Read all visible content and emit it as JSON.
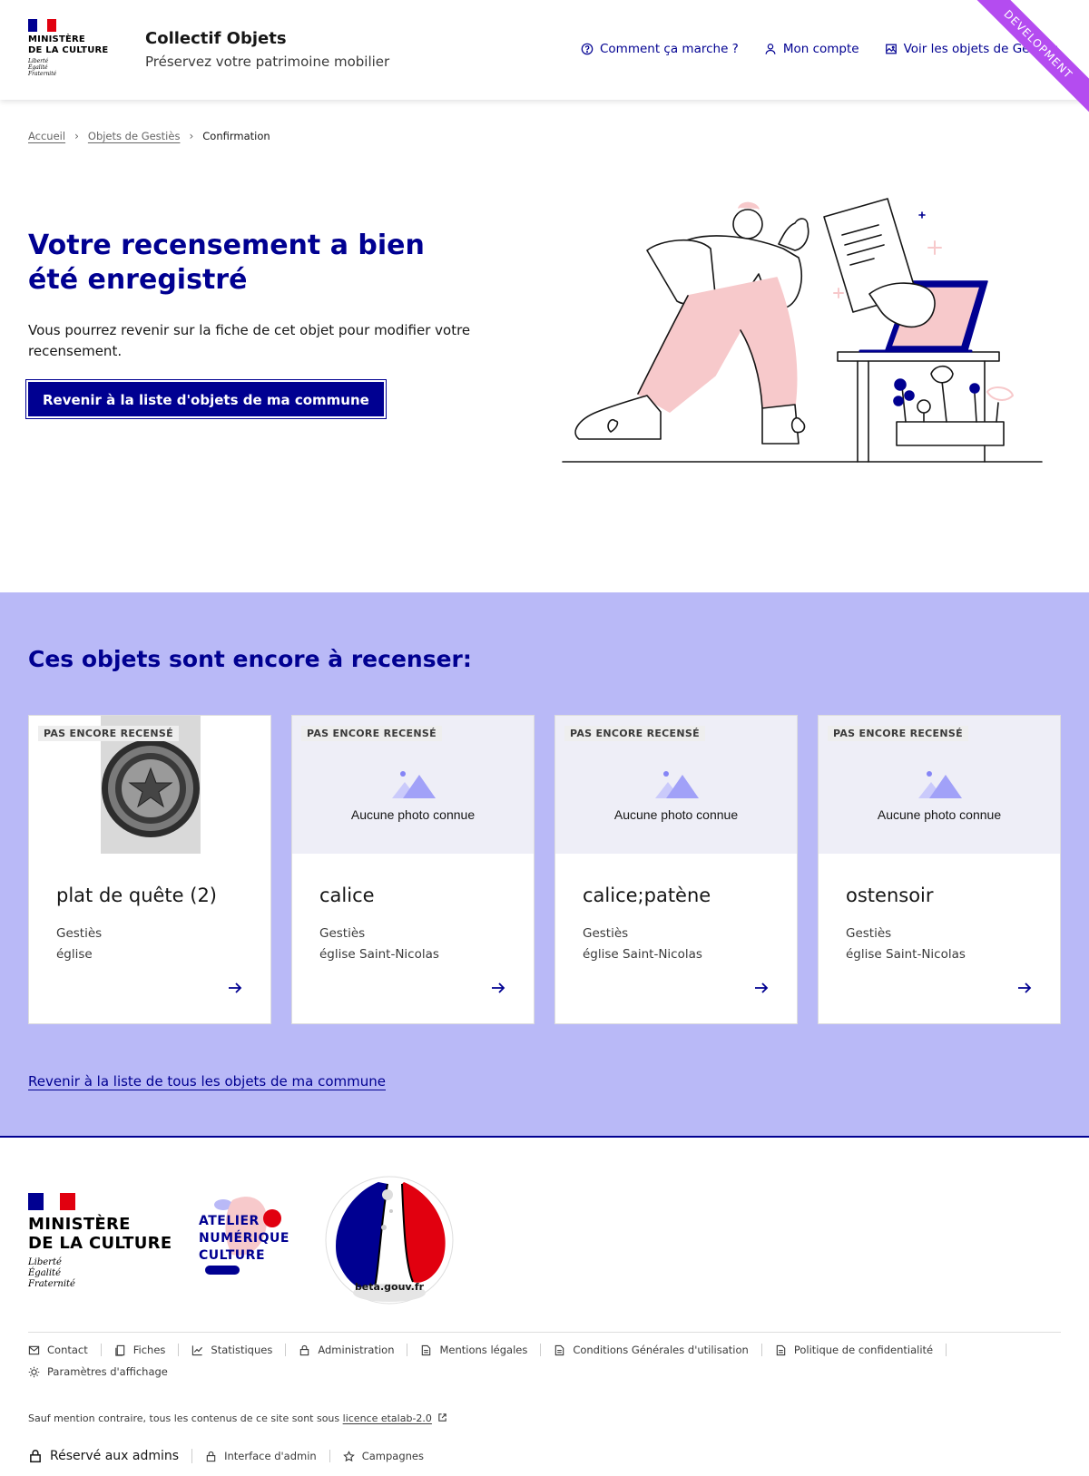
{
  "header": {
    "ministry_lines": [
      "MINISTÈRE",
      "DE LA CULTURE"
    ],
    "devise_lines": [
      "Liberté",
      "Égalité",
      "Fraternité"
    ],
    "site_title": "Collectif Objets",
    "tagline": "Préservez votre patrimoine mobilier",
    "nav": [
      {
        "label": "Comment ça marche ?",
        "icon": "question-circle-icon"
      },
      {
        "label": "Mon compte",
        "icon": "user-icon"
      },
      {
        "label": "Voir les objets de Gestiès",
        "icon": "image-icon"
      }
    ],
    "env_ribbon": "DEVELOPMENT"
  },
  "breadcrumb": {
    "items": [
      "Accueil",
      "Objets de Gestiès"
    ],
    "current": "Confirmation"
  },
  "hero": {
    "title": "Votre recensement a bien été enregistré",
    "text": "Vous pourrez revenir sur la fiche de cet objet pour modifier votre recensement.",
    "button": "Revenir à la liste d'objets de ma commune"
  },
  "todo": {
    "title": "Ces objets sont encore à recenser:",
    "cards": [
      {
        "badge": "PAS ENCORE RECENSÉ",
        "title": "plat de quête (2)",
        "commune": "Gestiès",
        "edifice": "église",
        "has_photo": true,
        "no_photo_text": ""
      },
      {
        "badge": "PAS ENCORE RECENSÉ",
        "title": "calice",
        "commune": "Gestiès",
        "edifice": "église Saint-Nicolas",
        "has_photo": false,
        "no_photo_text": "Aucune photo connue"
      },
      {
        "badge": "PAS ENCORE RECENSÉ",
        "title": "calice;patène",
        "commune": "Gestiès",
        "edifice": "église Saint-Nicolas",
        "has_photo": false,
        "no_photo_text": "Aucune photo connue"
      },
      {
        "badge": "PAS ENCORE RECENSÉ",
        "title": "ostensoir",
        "commune": "Gestiès",
        "edifice": "église Saint-Nicolas",
        "has_photo": false,
        "no_photo_text": "Aucune photo connue"
      }
    ],
    "back_all_link": "Revenir à la liste de tous les objets de ma commune"
  },
  "footer": {
    "ministry_lines": [
      "MINISTÈRE",
      "DE LA CULTURE"
    ],
    "devise_lines": [
      "Liberté",
      "Égalité",
      "Fraternité"
    ],
    "anc_lines": [
      "ATELIER",
      "NUMÉRIQUE",
      "CULTURE"
    ],
    "beta_label": "beta.gouv.fr",
    "links": [
      {
        "label": "Contact",
        "icon": "mail-icon"
      },
      {
        "label": "Fiches",
        "icon": "copy-icon"
      },
      {
        "label": "Statistiques",
        "icon": "chart-icon"
      },
      {
        "label": "Administration",
        "icon": "lock-icon"
      },
      {
        "label": "Mentions légales",
        "icon": "file-icon"
      },
      {
        "label": "Conditions Générales d'utilisation",
        "icon": "file-icon"
      },
      {
        "label": "Politique de confidentialité",
        "icon": "file-icon"
      },
      {
        "label": "Paramètres d'affichage",
        "icon": "sun-icon"
      }
    ],
    "licence_prefix": "Sauf mention contraire, tous les contenus de ce site sont sous ",
    "licence_link": "licence etalab-2.0",
    "admin_label": "Réservé aux admins",
    "admin_links": [
      "Interface d'admin",
      "Campagnes"
    ]
  },
  "colors": {
    "primary": "#000091",
    "section_bg": "#b9b9f7",
    "ribbon": "#b44cf0",
    "flag_blue": "#000091",
    "flag_red": "#e1000f",
    "illustration_pink": "#f7c9cb"
  }
}
